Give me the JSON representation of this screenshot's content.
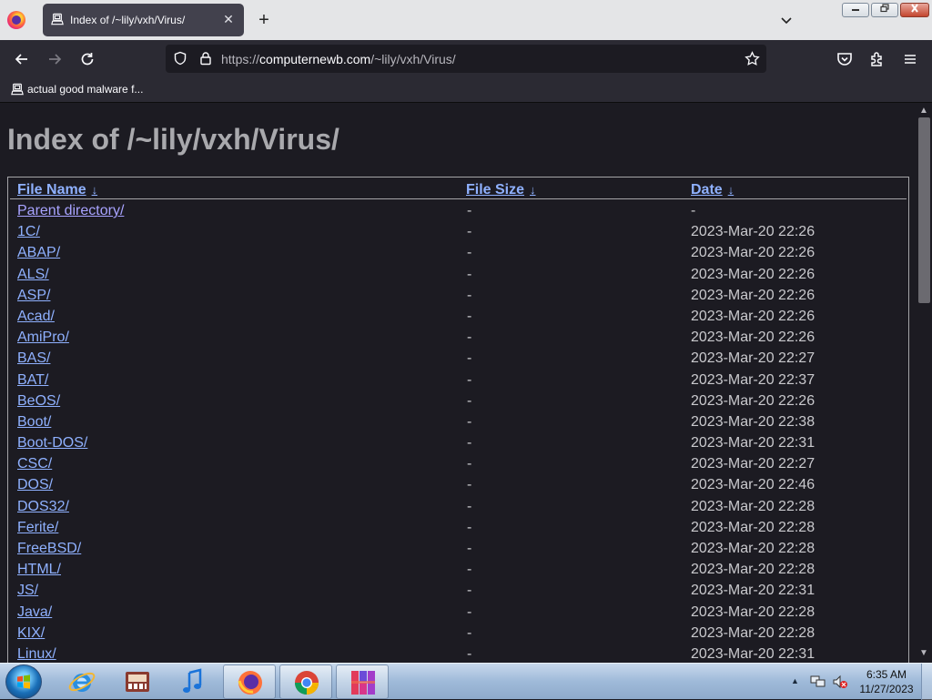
{
  "browser": {
    "tab": {
      "title": "Index of /~lily/vxh/Virus/",
      "favicon": "site-icon",
      "close_label": "✕"
    },
    "new_tab_label": "+",
    "url": {
      "scheme": "https://",
      "host": "computernewb.com",
      "path": "/~lily/vxh/Virus/"
    },
    "bookmarks": [
      {
        "label": "actual good malware f..."
      }
    ]
  },
  "page": {
    "heading": "Index of /~lily/vxh/Virus/",
    "columns": [
      {
        "label": "File Name",
        "arrow": "↓"
      },
      {
        "label": "File Size",
        "arrow": "↓"
      },
      {
        "label": "Date",
        "arrow": "↓"
      }
    ],
    "rows": [
      {
        "name": "Parent directory/",
        "size": "-",
        "date": "-"
      },
      {
        "name": "1C/",
        "size": "-",
        "date": "2023-Mar-20 22:26"
      },
      {
        "name": "ABAP/",
        "size": "-",
        "date": "2023-Mar-20 22:26"
      },
      {
        "name": "ALS/",
        "size": "-",
        "date": "2023-Mar-20 22:26"
      },
      {
        "name": "ASP/",
        "size": "-",
        "date": "2023-Mar-20 22:26"
      },
      {
        "name": "Acad/",
        "size": "-",
        "date": "2023-Mar-20 22:26"
      },
      {
        "name": "AmiPro/",
        "size": "-",
        "date": "2023-Mar-20 22:26"
      },
      {
        "name": "BAS/",
        "size": "-",
        "date": "2023-Mar-20 22:27"
      },
      {
        "name": "BAT/",
        "size": "-",
        "date": "2023-Mar-20 22:37"
      },
      {
        "name": "BeOS/",
        "size": "-",
        "date": "2023-Mar-20 22:26"
      },
      {
        "name": "Boot/",
        "size": "-",
        "date": "2023-Mar-20 22:38"
      },
      {
        "name": "Boot-DOS/",
        "size": "-",
        "date": "2023-Mar-20 22:31"
      },
      {
        "name": "CSC/",
        "size": "-",
        "date": "2023-Mar-20 22:27"
      },
      {
        "name": "DOS/",
        "size": "-",
        "date": "2023-Mar-20 22:46"
      },
      {
        "name": "DOS32/",
        "size": "-",
        "date": "2023-Mar-20 22:28"
      },
      {
        "name": "Ferite/",
        "size": "-",
        "date": "2023-Mar-20 22:28"
      },
      {
        "name": "FreeBSD/",
        "size": "-",
        "date": "2023-Mar-20 22:28"
      },
      {
        "name": "HTML/",
        "size": "-",
        "date": "2023-Mar-20 22:28"
      },
      {
        "name": "JS/",
        "size": "-",
        "date": "2023-Mar-20 22:31"
      },
      {
        "name": "Java/",
        "size": "-",
        "date": "2023-Mar-20 22:28"
      },
      {
        "name": "KIX/",
        "size": "-",
        "date": "2023-Mar-20 22:28"
      },
      {
        "name": "Linux/",
        "size": "-",
        "date": "2023-Mar-20 22:31"
      }
    ]
  },
  "taskbar": {
    "apps": [
      "internet-explorer-icon",
      "media-player-icon",
      "itunes-icon",
      "firefox-icon",
      "chrome-icon",
      "app-icon"
    ],
    "clock": {
      "time": "6:35 AM",
      "date": "11/27/2023"
    }
  },
  "colors": {
    "link": "#8fb1ff",
    "visited": "#a8a3ff",
    "page_bg": "#1c1b22",
    "heading": "#a9a9ad"
  }
}
